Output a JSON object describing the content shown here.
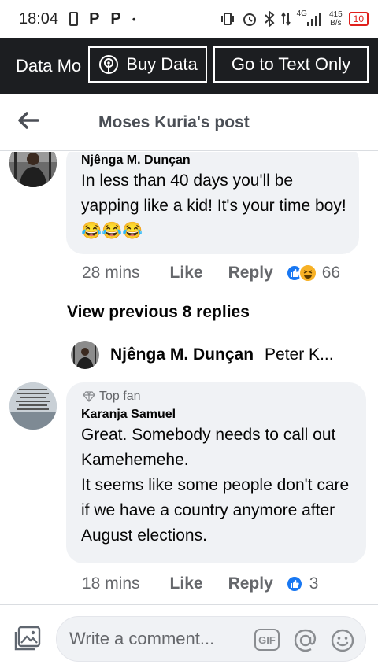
{
  "status_bar": {
    "time": "18:04",
    "p1": "P",
    "p2": "P",
    "dot": "•",
    "network": "4G",
    "speed_value": "415",
    "speed_unit": "B/s",
    "battery": "10"
  },
  "data_bar": {
    "mode_label": "Data Mo",
    "buy_label": "Buy Data",
    "text_only_label": "Go to Text Only"
  },
  "header": {
    "title": "Moses Kuria's post"
  },
  "comments": [
    {
      "author": "Njênga M. Dunçan",
      "text": "In less than 40 days you'll be yapping like a kid! It's your time boy! 😂😂😂",
      "time": "28 mins",
      "like_label": "Like",
      "reply_label": "Reply",
      "reaction_count": "66"
    },
    {
      "badge": "Top fan",
      "author": "Karanja Samuel",
      "text": "Great. Somebody needs to call out Kamehemehe.\nIt seems like some people don't care if we have a country anymore after August elections.",
      "time": "18 mins",
      "like_label": "Like",
      "reply_label": "Reply",
      "reaction_count": "3"
    }
  ],
  "view_previous": "View previous 8 replies",
  "reply_preview": {
    "name": "Njênga M. Dunçan",
    "snippet": "Peter K..."
  },
  "composer": {
    "placeholder": "Write a comment...",
    "gif_label": "GIF"
  },
  "colors": {
    "data_bar_bg": "#1c1e21",
    "like_blue": "#1877f2",
    "bubble_bg": "#f0f2f5",
    "battery_red": "#e0201c"
  }
}
